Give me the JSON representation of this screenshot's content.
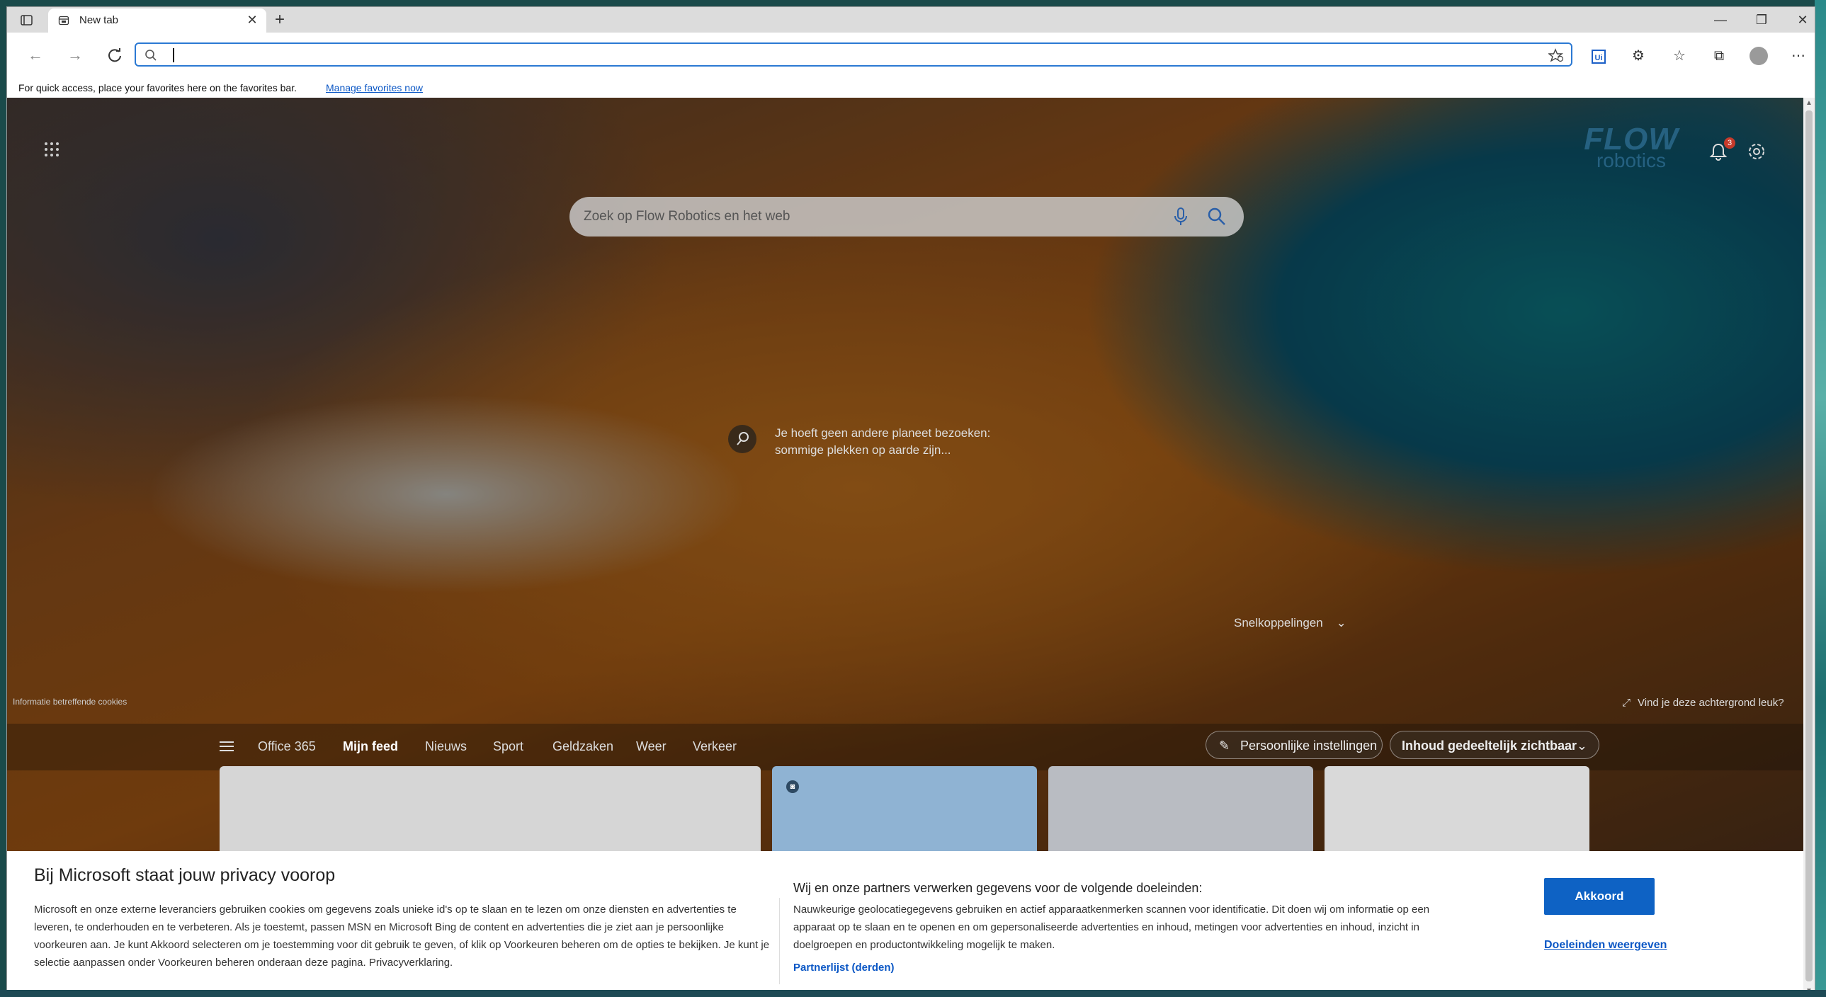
{
  "browser": {
    "tab": {
      "title": "New tab",
      "favicon": "newtab-icon"
    },
    "address_bar": {
      "value": "",
      "placeholder": ""
    },
    "favorites_bar": {
      "message": "For quick access, place your favorites here on the favorites bar.",
      "link": "Manage favorites now"
    }
  },
  "newtab": {
    "logo": {
      "line1": "FLOW",
      "line2": "robotics"
    },
    "notification_count": "3",
    "search_placeholder": "Zoek op Flow Robotics en het web",
    "image_caption": "Je hoeft geen andere planeet bezoeken: sommige plekken op aarde zijn...",
    "shortcuts_label": "Snelkoppelingen",
    "cookies_info": "Informatie betreffende cookies",
    "background_question": "Vind je deze achtergrond leuk?",
    "feed": {
      "items": [
        "Office 365",
        "Mijn feed",
        "Nieuws",
        "Sport",
        "Geldzaken",
        "Weer",
        "Verkeer"
      ],
      "active": "Mijn feed",
      "personal_settings": "Persoonlijke instellingen",
      "content_visibility": "Inhoud gedeeltelijk zichtbaar"
    }
  },
  "privacy": {
    "title": "Bij Microsoft staat jouw privacy voorop",
    "body": "Microsoft en onze externe leveranciers gebruiken cookies om gegevens zoals unieke id's op te slaan en te lezen om onze diensten en advertenties te leveren, te onderhouden en te verbeteren. Als je toestemt, passen MSN en Microsoft Bing de content en advertenties die je ziet aan je persoonlijke voorkeuren aan. Je kunt Akkoord selecteren om je toestemming voor dit gebruik te geven, of klik op Voorkeuren beheren om de opties te bekijken. Je kunt je selectie aanpassen onder Voorkeuren beheren onderaan deze pagina. Privacyverklaring.",
    "purposes_title": "Wij en onze partners verwerken gegevens voor de volgende doeleinden:",
    "purposes_body": "Nauwkeurige geolocatiegegevens gebruiken en actief apparaatkenmerken scannen voor identificatie. Dit doen wij om informatie op een apparaat op te slaan en te openen en om gepersonaliseerde advertenties en inhoud, metingen voor advertenties en inhoud, inzicht in doelgroepen en productontwikkeling mogelijk te maken.",
    "partner_link": "Partnerlijst (derden)",
    "accept_button": "Akkoord",
    "purposes_link": "Doeleinden weergeven"
  },
  "colors": {
    "accent": "#0e62c4",
    "link": "#0b57c5",
    "badge": "#c53a2b"
  }
}
